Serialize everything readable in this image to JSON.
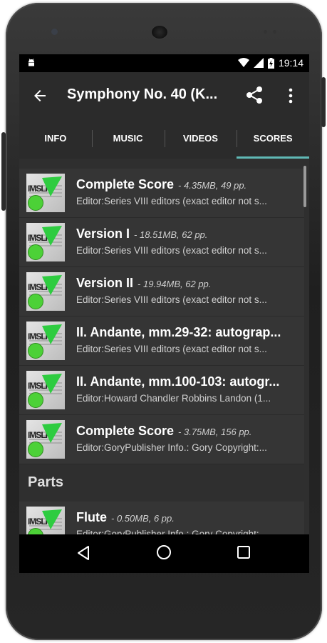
{
  "status": {
    "time": "19:14"
  },
  "appbar": {
    "title": "Symphony No. 40 (K..."
  },
  "tabs": [
    {
      "label": "INFO"
    },
    {
      "label": "MUSIC"
    },
    {
      "label": "VIDEOS"
    },
    {
      "label": "SCORES"
    }
  ],
  "scores": [
    {
      "name": "Complete Score",
      "meta": "- 4.35MB, 49 pp.",
      "editor": "Editor:Series VIII editors (exact editor not s..."
    },
    {
      "name": "Version I",
      "meta": "- 18.51MB, 62 pp.",
      "editor": "Editor:Series VIII editors (exact editor not s..."
    },
    {
      "name": "Version II",
      "meta": "- 19.94MB, 62 pp.",
      "editor": "Editor:Series VIII editors (exact editor not s..."
    },
    {
      "name": "II. Andante, mm.29-32: autograp...",
      "meta": "",
      "editor": "Editor:Series VIII editors (exact editor not s..."
    },
    {
      "name": "II. Andante, mm.100-103: autogr...",
      "meta": "",
      "editor": "Editor:Howard Chandler Robbins Landon (1..."
    },
    {
      "name": "Complete Score",
      "meta": "- 3.75MB, 156 pp.",
      "editor": "Editor:GoryPublisher Info.: Gory Copyright:..."
    }
  ],
  "parts_section": {
    "title": "Parts"
  },
  "parts": [
    {
      "name": "Flute",
      "meta": "- 0.50MB, 6 pp.",
      "editor": "Editor:GoryPublisher Info.: Gory Copyright:..."
    }
  ],
  "thumb_label": "IMSLP",
  "colors": {
    "accent": "#5fb8b5",
    "appbar": "#2b2b2b",
    "list_bg": "#2f2f2f",
    "card": "#353535",
    "green": "#4cd137"
  }
}
